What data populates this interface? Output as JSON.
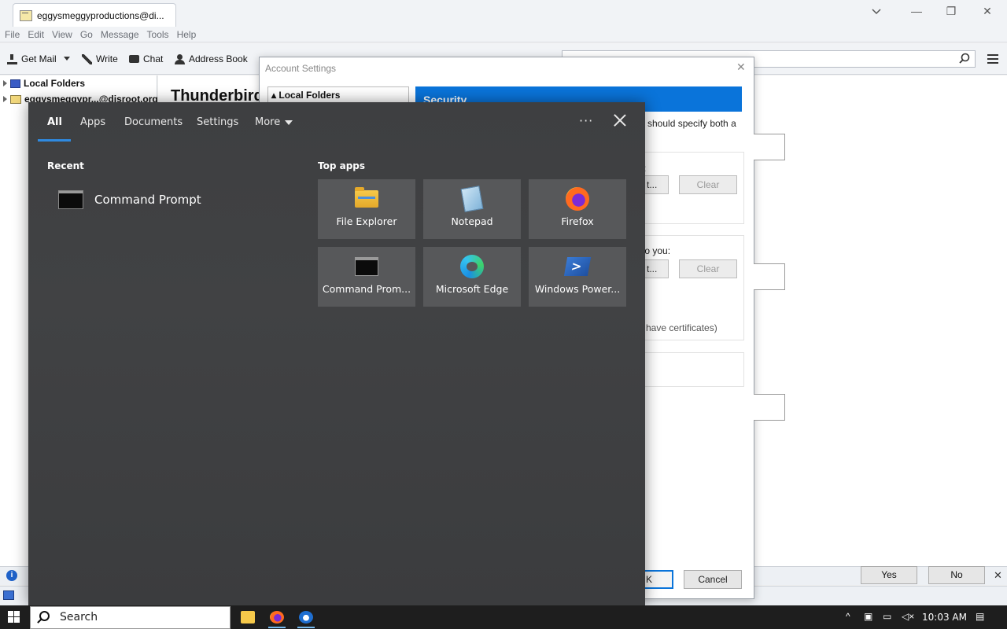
{
  "thunderbird": {
    "tab_title": "eggysmeggyproductions@di...",
    "menu": [
      "File",
      "Edit",
      "View",
      "Go",
      "Message",
      "Tools",
      "Help"
    ],
    "toolbar": {
      "get_mail": "Get Mail",
      "write": "Write",
      "chat": "Chat",
      "address_book": "Address Book"
    },
    "folders": {
      "local_folders": "Local Folders",
      "account": "eggysmeggypr...@disroot.org"
    },
    "main_title": "Thunderbird",
    "notification": {
      "yes": "Yes",
      "no": "No"
    }
  },
  "account_settings": {
    "title": "Account Settings",
    "tree_item": "Local Folders",
    "header": "Security",
    "text_should_specify": "should specify both a",
    "text_to_you": "to you:",
    "text_have_certs": "have certificates)",
    "select_partial": "t...",
    "clear": "Clear",
    "ok_partial": "K",
    "cancel": "Cancel"
  },
  "search_panel": {
    "tabs": {
      "all": "All",
      "apps": "Apps",
      "documents": "Documents",
      "settings": "Settings",
      "more": "More"
    },
    "more_options": "···",
    "recent_heading": "Recent",
    "recent_item": "Command Prompt",
    "top_apps_heading": "Top apps",
    "top_apps": [
      {
        "label": "File Explorer",
        "icon": "folder-icon"
      },
      {
        "label": "Notepad",
        "icon": "notepad-icon"
      },
      {
        "label": "Firefox",
        "icon": "firefox-icon"
      },
      {
        "label": "Command Prom...",
        "icon": "command-prompt-icon"
      },
      {
        "label": "Microsoft Edge",
        "icon": "edge-icon"
      },
      {
        "label": "Windows Power...",
        "icon": "powershell-icon"
      }
    ]
  },
  "taskbar": {
    "search_placeholder": "Search",
    "clock": "10:03 AM"
  },
  "colors": {
    "accent_blue": "#0a74da",
    "search_panel_bg": "#404143",
    "tile_bg": "#57585a",
    "taskbar_bg": "#1e1e1e",
    "tab_underline": "#2f8ae0"
  }
}
